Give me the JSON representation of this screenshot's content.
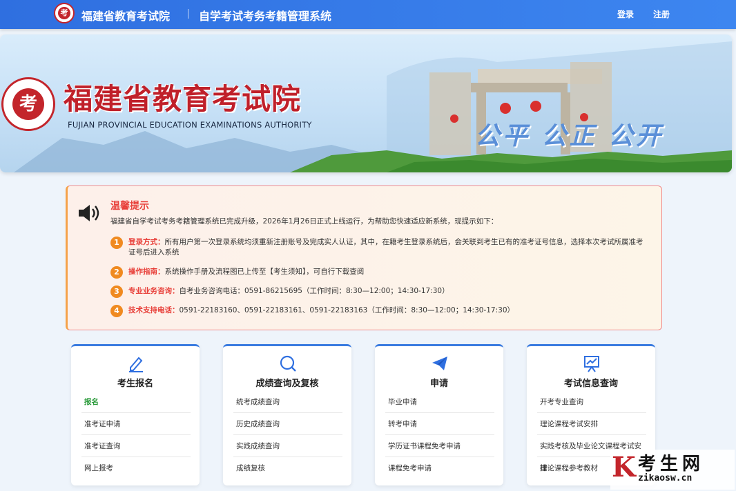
{
  "header": {
    "site_name": "福建省教育考试院",
    "system_name": "自学考试考务考籍管理系统",
    "logo_text": "考",
    "login": "登录",
    "register": "注册"
  },
  "banner": {
    "title": "福建省教育考试院",
    "subtitle_en": "FUJIAN PROVINCIAL EDUCATION EXAMINATIONS AUTHORITY",
    "slogan": "公平 公正 公开",
    "logo_text": "考"
  },
  "notice": {
    "title": "温馨提示",
    "intro": "福建省自学考试考务考籍管理系统已完成升级，2026年1月26日正式上线运行，为帮助您快速适应新系统，现提示如下：",
    "items": [
      {
        "num": "1",
        "label": "登录方式：",
        "text": "所有用户第一次登录系统均须重新注册账号及完成实人认证，其中，在籍考生登录系统后，会关联到考生已有的准考证号信息，选择本次考试所属准考证号后进入系统"
      },
      {
        "num": "2",
        "label": "操作指南：",
        "text": "系统操作手册及流程图已上传至【考生须知】，可自行下载查阅"
      },
      {
        "num": "3",
        "label": "专业业务咨询：",
        "text": "自考业务咨询电话：0591-86215695（工作时间：8:30—12:00；14:30-17:30）"
      },
      {
        "num": "4",
        "label": "技术支持电话：",
        "text": "0591-22183160、0591-22183161、0591-22183163（工作时间：8:30—12:00；14:30-17:30）"
      }
    ]
  },
  "cards": [
    {
      "title": "考生报名",
      "icon": "pencil-icon",
      "items": [
        "报名",
        "准考证申请",
        "准考证查询",
        "网上报考"
      ]
    },
    {
      "title": "成绩查询及复核",
      "icon": "search-icon",
      "items": [
        "统考成绩查询",
        "历史成绩查询",
        "实践成绩查询",
        "成绩复核"
      ]
    },
    {
      "title": "申请",
      "icon": "paper-plane-icon",
      "items": [
        "毕业申请",
        "转考申请",
        "学历证书课程免考申请",
        "课程免考申请"
      ]
    },
    {
      "title": "考试信息查询",
      "icon": "chart-board-icon",
      "items": [
        "开考专业查询",
        "理论课程考试安排",
        "实践考核及毕业论文课程考试安排",
        "理论课程参考教材"
      ]
    }
  ],
  "watermark": {
    "letter": "K",
    "text": "考生网",
    "url": "zikaosw.cn"
  },
  "colors": {
    "header_blue": "#3a7be0",
    "brand_red": "#c3252b",
    "notice_red": "#e8403a",
    "badge_orange": "#f08a20",
    "active_green": "#2a9a3a"
  }
}
